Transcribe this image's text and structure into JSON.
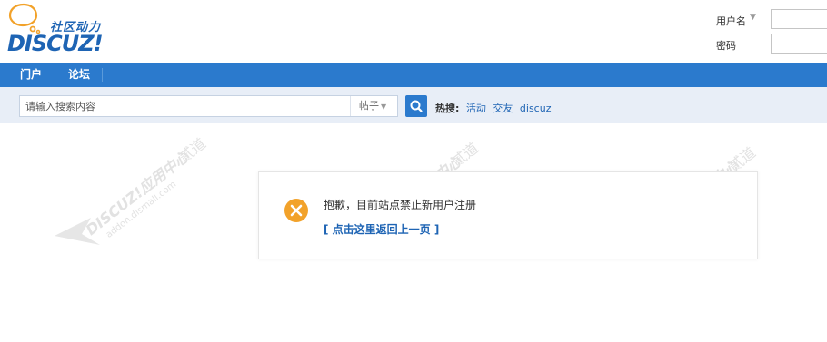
{
  "header": {
    "logo_tagline": "社区动力",
    "logo_brand": "DISCUZ",
    "logo_brand_suffix": "!"
  },
  "login": {
    "username_label": "用户名",
    "password_label": "密码"
  },
  "nav": {
    "items": [
      {
        "label": "门户"
      },
      {
        "label": "论坛"
      }
    ]
  },
  "search": {
    "placeholder": "请输入搜索内容",
    "type_label": "帖子",
    "hot_label": "热搜:",
    "hot_links": [
      "活动",
      "交友",
      "discuz"
    ]
  },
  "message": {
    "text": "抱歉，目前站点禁止新用户注册",
    "back_link": "[ 点击这里返回上一页 ]"
  },
  "watermark": {
    "brand": "DISCUZ!应用中心",
    "site": "addon.dismall.com",
    "author": "贰道"
  },
  "colors": {
    "brand_blue": "#2b7acd",
    "link_blue": "#1e64b4",
    "search_bg": "#e8eef7",
    "error_orange": "#f2a22a"
  }
}
